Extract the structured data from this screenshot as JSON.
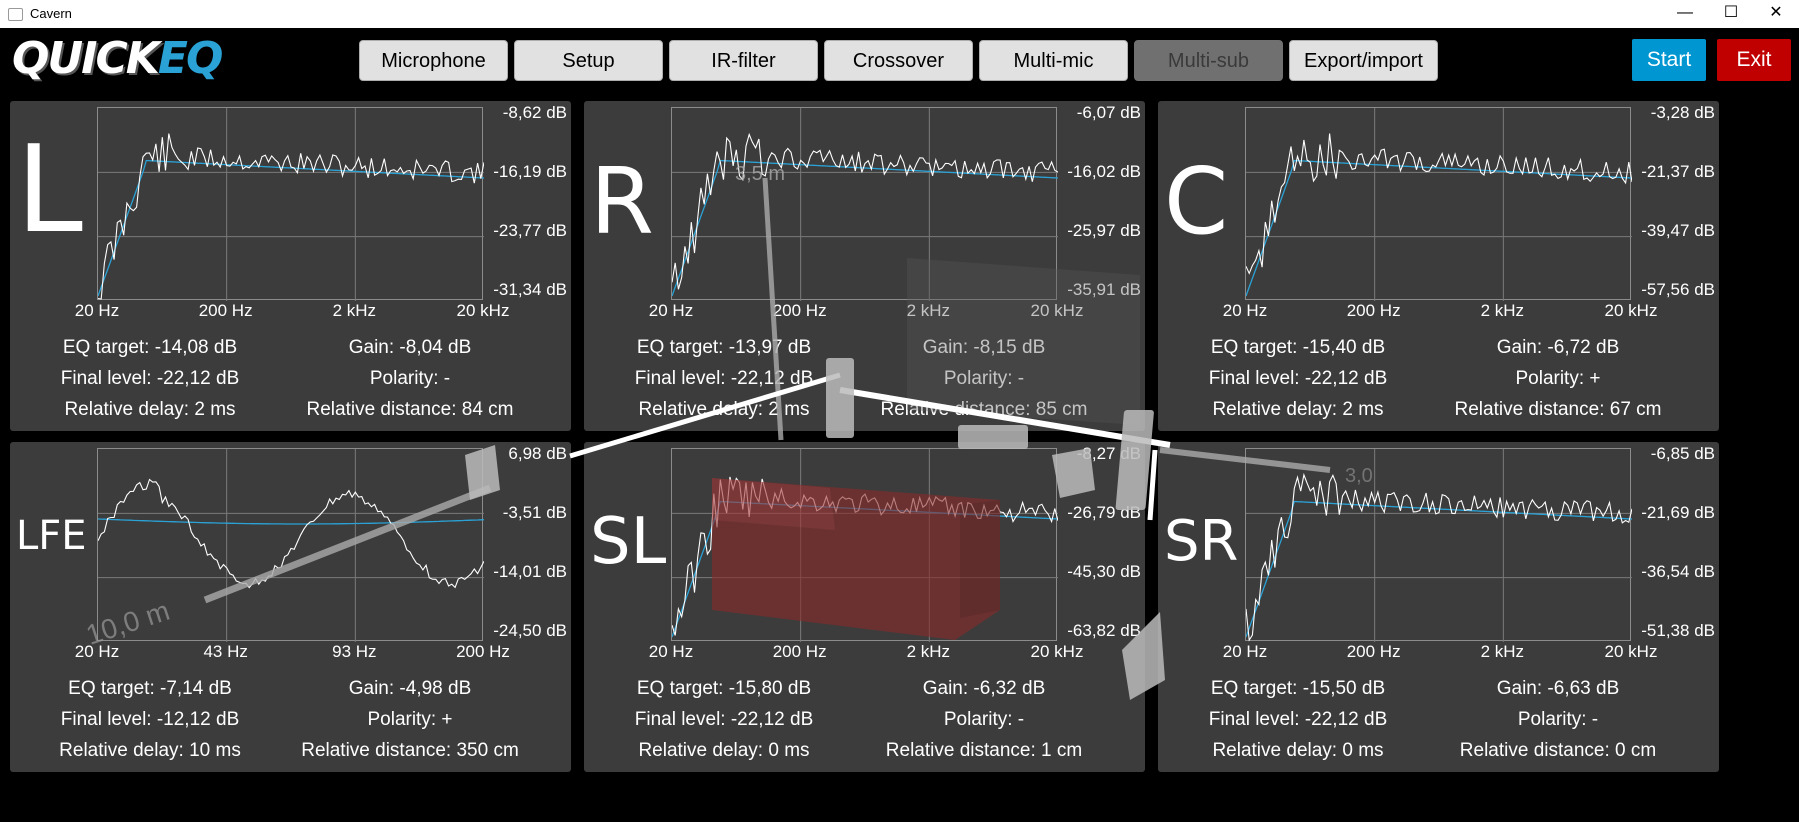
{
  "window": {
    "title": "Cavern",
    "minimize": "—",
    "maximize": "☐",
    "close": "✕"
  },
  "logo": {
    "quick": "QUICK",
    "eq": "EQ"
  },
  "tabs": [
    {
      "label": "Microphone",
      "disabled": false
    },
    {
      "label": "Setup",
      "disabled": false
    },
    {
      "label": "IR-filter",
      "disabled": false
    },
    {
      "label": "Crossover",
      "disabled": false
    },
    {
      "label": "Multi-mic",
      "disabled": false
    },
    {
      "label": "Multi-sub",
      "disabled": true
    },
    {
      "label": "Export/import",
      "disabled": false
    }
  ],
  "buttons": {
    "start": "Start",
    "exit": "Exit"
  },
  "colors": {
    "accent": "#0096d2",
    "exit": "#c00000",
    "panel": "#3c3c3c",
    "curve_measured": "#ffffff",
    "curve_target": "#2aa2d6"
  },
  "overlay": {
    "distance_top": "3,5 m",
    "distance_left": "10,0 m",
    "distance_right": "3,0"
  },
  "panels": [
    {
      "label": "L",
      "y_ticks": [
        "-8,62 dB",
        "-16,19 dB",
        "-23,77 dB",
        "-31,34 dB"
      ],
      "x_ticks": [
        "20 Hz",
        "200 Hz",
        "2 kHz",
        "20 kHz"
      ],
      "eq_target": "EQ target: -14,08 dB",
      "gain": "Gain: -8,04 dB",
      "final_level": "Final level: -22,12 dB",
      "polarity": "Polarity: -",
      "delay": "Relative delay: 2 ms",
      "distance": "Relative distance: 84 cm"
    },
    {
      "label": "R",
      "y_ticks": [
        "-6,07 dB",
        "-16,02 dB",
        "-25,97 dB",
        "-35,91 dB"
      ],
      "x_ticks": [
        "20 Hz",
        "200 Hz",
        "2 kHz",
        "20 kHz"
      ],
      "eq_target": "EQ target: -13,97 dB",
      "gain": "Gain: -8,15 dB",
      "final_level": "Final level: -22,12 dB",
      "polarity": "Polarity: -",
      "delay": "Relative delay: 2 ms",
      "distance": "Relative distance: 85 cm"
    },
    {
      "label": "C",
      "y_ticks": [
        "-3,28 dB",
        "-21,37 dB",
        "-39,47 dB",
        "-57,56 dB"
      ],
      "x_ticks": [
        "20 Hz",
        "200 Hz",
        "2 kHz",
        "20 kHz"
      ],
      "eq_target": "EQ target: -15,40 dB",
      "gain": "Gain: -6,72 dB",
      "final_level": "Final level: -22,12 dB",
      "polarity": "Polarity: +",
      "delay": "Relative delay: 2 ms",
      "distance": "Relative distance: 67 cm"
    },
    {
      "label": "LFE",
      "y_ticks": [
        "6,98 dB",
        "-3,51 dB",
        "-14,01 dB",
        "-24,50 dB"
      ],
      "x_ticks": [
        "20 Hz",
        "43 Hz",
        "93 Hz",
        "200 Hz"
      ],
      "eq_target": "EQ target: -7,14 dB",
      "gain": "Gain: -4,98 dB",
      "final_level": "Final level: -12,12 dB",
      "polarity": "Polarity: +",
      "delay": "Relative delay: 10 ms",
      "distance": "Relative distance: 350 cm"
    },
    {
      "label": "SL",
      "y_ticks": [
        "-8,27 dB",
        "-26,79 dB",
        "-45,30 dB",
        "-63,82 dB"
      ],
      "x_ticks": [
        "20 Hz",
        "200 Hz",
        "2 kHz",
        "20 kHz"
      ],
      "eq_target": "EQ target: -15,80 dB",
      "gain": "Gain: -6,32 dB",
      "final_level": "Final level: -22,12 dB",
      "polarity": "Polarity: -",
      "delay": "Relative delay: 0 ms",
      "distance": "Relative distance: 1 cm"
    },
    {
      "label": "SR",
      "y_ticks": [
        "-6,85 dB",
        "-21,69 dB",
        "-36,54 dB",
        "-51,38 dB"
      ],
      "x_ticks": [
        "20 Hz",
        "200 Hz",
        "2 kHz",
        "20 kHz"
      ],
      "eq_target": "EQ target: -15,50 dB",
      "gain": "Gain: -6,63 dB",
      "final_level": "Final level: -22,12 dB",
      "polarity": "Polarity: -",
      "delay": "Relative delay: 0 ms",
      "distance": "Relative distance: 0 cm"
    }
  ]
}
